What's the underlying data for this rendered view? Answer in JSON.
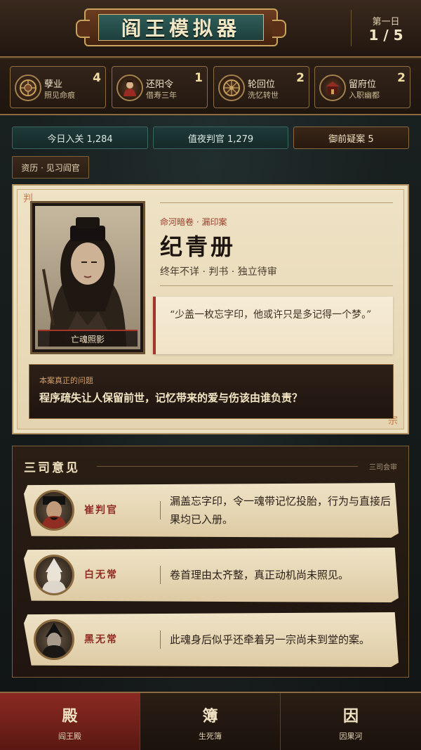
{
  "header": {
    "title": "阎王模拟器",
    "day_label": "第一日",
    "day_progress": "1 / 5"
  },
  "resources": [
    {
      "name": "孽业",
      "sub": "照见命痕",
      "count": "4",
      "icon": "karma-medallion-icon"
    },
    {
      "name": "还阳令",
      "sub": "借寿三年",
      "count": "1",
      "icon": "revival-token-icon"
    },
    {
      "name": "轮回位",
      "sub": "洗忆转世",
      "count": "2",
      "icon": "wheel-icon"
    },
    {
      "name": "留府位",
      "sub": "入职幽都",
      "count": "2",
      "icon": "mansion-seat-icon"
    }
  ],
  "stats": {
    "today_entered": "今日入关 1,284",
    "night_judges": "值夜判官 1,279",
    "pending_cases": "御前疑案 5"
  },
  "rank_tag": "资历 · 见习阎官",
  "case": {
    "seal_top": "判",
    "seal_bottom": "宗",
    "kicker": "命河暗卷 · 漏印案",
    "name": "纪青册",
    "meta": "终年不详 · 判书 · 独立待审",
    "portrait_caption": "亡魂照影",
    "quote": "“少盖一枚忘字印，他或许只是多记得一个梦。”",
    "question_label": "本案真正的问题",
    "question": "程序疏失让人保留前世，记忆带来的爱与伤该由谁负责？"
  },
  "opinions": {
    "title": "三司意见",
    "tag": "三司会审",
    "items": [
      {
        "name": "崔判官",
        "text": "漏盖忘字印，令一魂带记忆投胎，行为与直接后果均已入册。"
      },
      {
        "name": "白无常",
        "text": "卷首理由太齐整，真正动机尚未照见。"
      },
      {
        "name": "黑无常",
        "text": "此魂身后似乎还牵着另一宗尚未到堂的案。"
      }
    ]
  },
  "nav": [
    {
      "glyph": "殿",
      "label": "阎王殿",
      "active": true
    },
    {
      "glyph": "簿",
      "label": "生死簿",
      "active": false
    },
    {
      "glyph": "因",
      "label": "因果河",
      "active": false
    }
  ],
  "colors": {
    "accent_red": "#8a2a22",
    "gold": "#c9a25e",
    "teal": "#1e3a39",
    "parchment": "#efe3c6"
  }
}
